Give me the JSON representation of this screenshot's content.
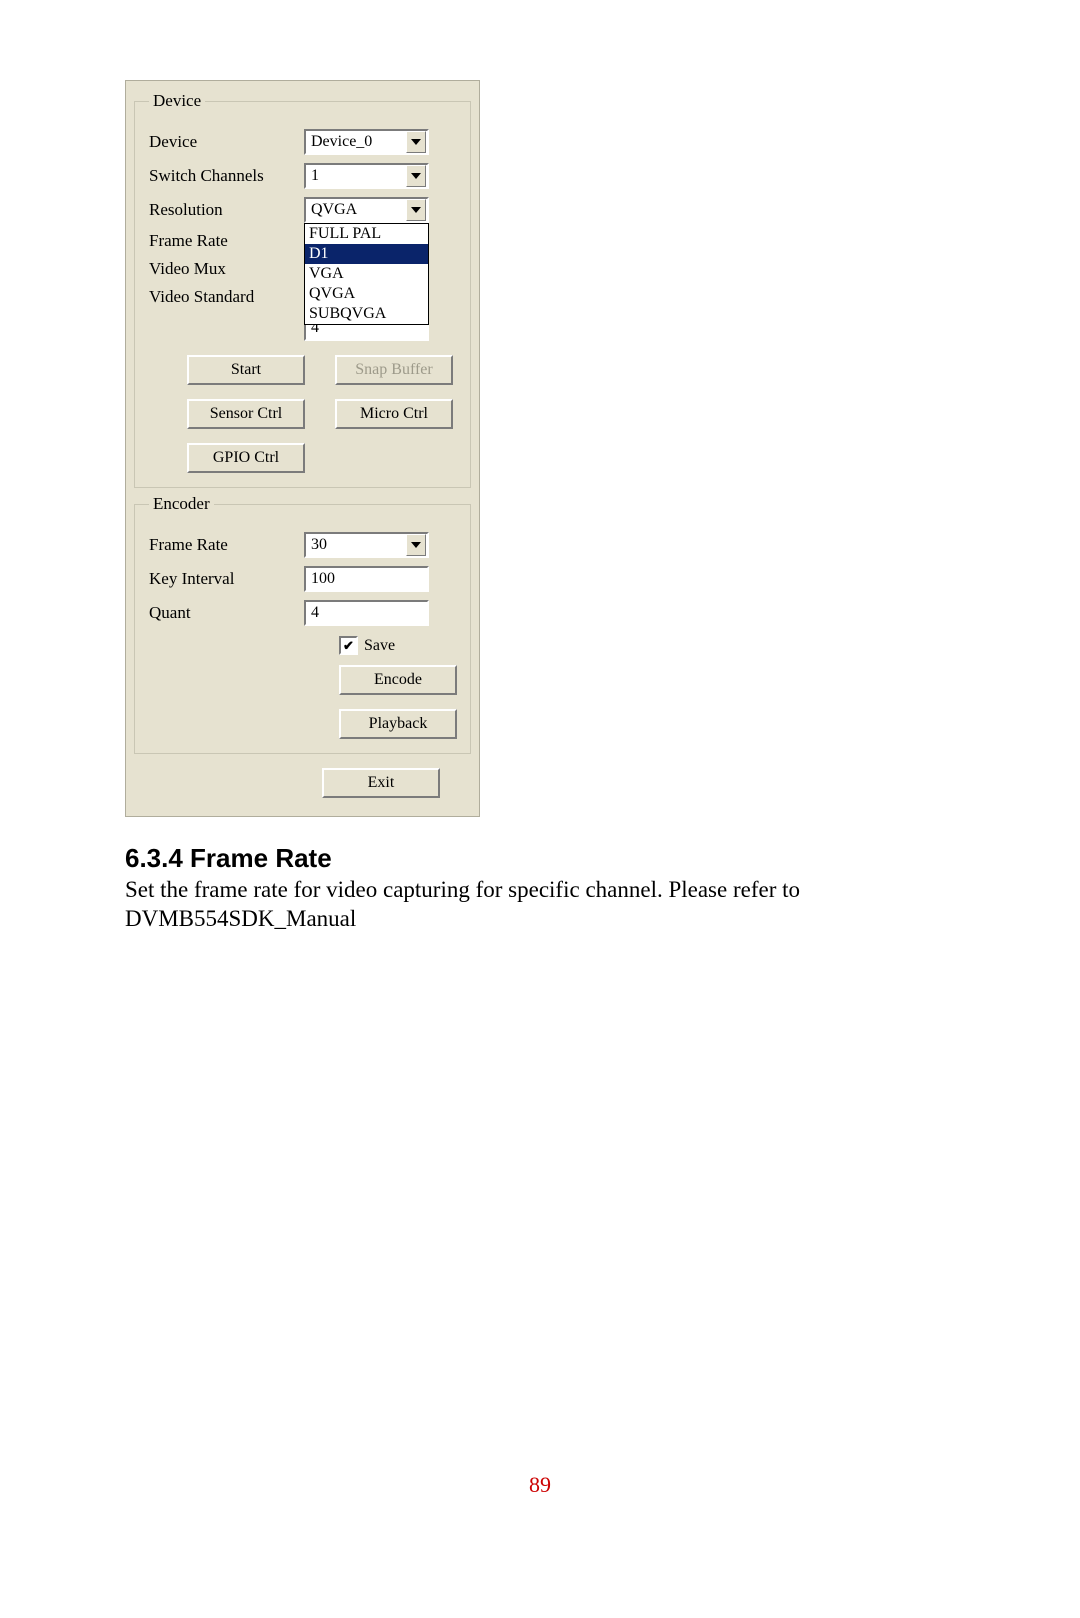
{
  "dialog": {
    "device_group": {
      "legend": "Device",
      "rows": {
        "device": {
          "label": "Device",
          "value": "Device_0"
        },
        "switch_channels": {
          "label": "Switch Channels",
          "value": "1"
        },
        "resolution": {
          "label": "Resolution",
          "value": "QVGA"
        },
        "frame_rate": {
          "label": "Frame Rate"
        },
        "video_mux": {
          "label": "Video Mux"
        },
        "video_standard": {
          "label": "Video Standard"
        }
      },
      "resolution_options": [
        "FULL PAL",
        "D1",
        "VGA",
        "QVGA",
        "SUBQVGA"
      ],
      "resolution_selected_index": 1,
      "stray_value": "4",
      "buttons": {
        "start": "Start",
        "snap_buffer": "Snap Buffer",
        "sensor_ctrl": "Sensor Ctrl",
        "micro_ctrl": "Micro Ctrl",
        "gpio_ctrl": "GPIO Ctrl"
      }
    },
    "encoder_group": {
      "legend": "Encoder",
      "rows": {
        "frame_rate": {
          "label": "Frame Rate",
          "value": "30"
        },
        "key_interval": {
          "label": "Key Interval",
          "value": "100"
        },
        "quant": {
          "label": "Quant",
          "value": "4"
        }
      },
      "save_checkbox": {
        "label": "Save",
        "checked": true
      },
      "buttons": {
        "encode": "Encode",
        "playback": "Playback"
      }
    },
    "exit_button": "Exit"
  },
  "text": {
    "heading": "6.3.4 Frame Rate",
    "body": "Set the frame rate for video capturing for specific channel. Please refer to DVMB554SDK_Manual"
  },
  "page_number": "89"
}
